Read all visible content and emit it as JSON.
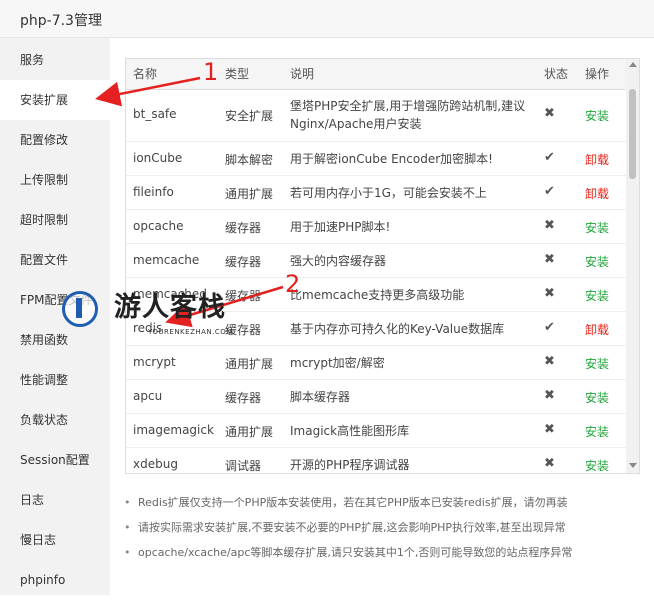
{
  "window": {
    "title": "php-7.3管理"
  },
  "sidebar": {
    "items": [
      {
        "label": "服务"
      },
      {
        "label": "安装扩展",
        "active": true
      },
      {
        "label": "配置修改"
      },
      {
        "label": "上传限制"
      },
      {
        "label": "超时限制"
      },
      {
        "label": "配置文件"
      },
      {
        "label": "FPM配置文件"
      },
      {
        "label": "禁用函数"
      },
      {
        "label": "性能调整"
      },
      {
        "label": "负载状态"
      },
      {
        "label": "Session配置"
      },
      {
        "label": "日志"
      },
      {
        "label": "慢日志"
      },
      {
        "label": "phpinfo"
      }
    ]
  },
  "table": {
    "headers": {
      "name": "名称",
      "type": "类型",
      "desc": "说明",
      "status": "状态",
      "op": "操作"
    },
    "rows": [
      {
        "name": "bt_safe",
        "type": "安全扩展",
        "desc": "堡塔PHP安全扩展,用于增强防跨站机制,建议Nginx/Apache用户安装",
        "status": "✖",
        "op": "安装",
        "installed": false
      },
      {
        "name": "ionCube",
        "type": "脚本解密",
        "desc": "用于解密ionCube Encoder加密脚本!",
        "status": "✔",
        "op": "卸载",
        "installed": true
      },
      {
        "name": "fileinfo",
        "type": "通用扩展",
        "desc": "若可用内存小于1G，可能会安装不上",
        "status": "✔",
        "op": "卸载",
        "installed": true
      },
      {
        "name": "opcache",
        "type": "缓存器",
        "desc": "用于加速PHP脚本!",
        "status": "✖",
        "op": "安装",
        "installed": false
      },
      {
        "name": "memcache",
        "type": "缓存器",
        "desc": "强大的内容缓存器",
        "status": "✖",
        "op": "安装",
        "installed": false
      },
      {
        "name": "memcached",
        "type": "缓存器",
        "desc": "比memcache支持更多高级功能",
        "status": "✖",
        "op": "安装",
        "installed": false
      },
      {
        "name": "redis",
        "type": "缓存器",
        "desc": "基于内存亦可持久化的Key-Value数据库",
        "status": "✔",
        "op": "卸载",
        "installed": true
      },
      {
        "name": "mcrypt",
        "type": "通用扩展",
        "desc": "mcrypt加密/解密",
        "status": "✖",
        "op": "安装",
        "installed": false
      },
      {
        "name": "apcu",
        "type": "缓存器",
        "desc": "脚本缓存器",
        "status": "✖",
        "op": "安装",
        "installed": false
      },
      {
        "name": "imagemagick",
        "type": "通用扩展",
        "desc": "Imagick高性能图形库",
        "status": "✖",
        "op": "安装",
        "installed": false
      },
      {
        "name": "xdebug",
        "type": "调试器",
        "desc": "开源的PHP程序调试器",
        "status": "✖",
        "op": "安装",
        "installed": false
      }
    ]
  },
  "notes": [
    "Redis扩展仅支持一个PHP版本安装使用，若在其它PHP版本已安装redis扩展，请勿再装",
    "请按实际需求安装扩展,不要安装不必要的PHP扩展,这会影响PHP执行效率,甚至出现异常",
    "opcache/xcache/apc等脚本缓存扩展,请只安装其中1个,否则可能导致您的站点程序异常"
  ],
  "annotations": {
    "marker_1": "1",
    "marker_2": "2"
  },
  "watermark": {
    "text": "游人客栈",
    "sub": "YOURENKEZHAN.COM"
  },
  "colors": {
    "install": "#20a53a",
    "uninstall": "#e62117",
    "arrow": "#e52020"
  }
}
